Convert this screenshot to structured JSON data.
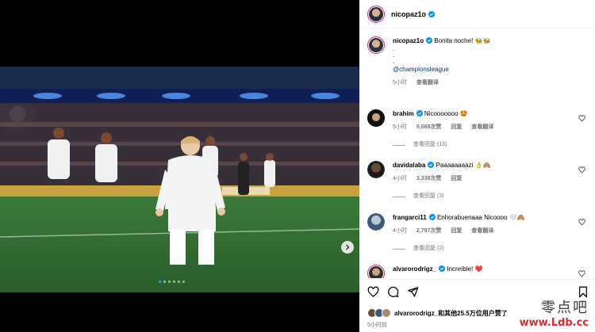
{
  "post": {
    "username": "nicopaz1o",
    "caption_lines": [
      "Bonita noche! 🐝🐝",
      ".",
      ".",
      "."
    ],
    "caption_mention": "@championsleague",
    "caption_time": "5小时",
    "caption_translate": "查看翻译",
    "carousel": {
      "total": 6,
      "active_index": 0
    }
  },
  "comments": [
    {
      "username": "brahim",
      "text": "Nicooooooo 🤩",
      "time": "5小时",
      "likes": "5,668次赞",
      "reply": "回复",
      "translate": "查看翻译",
      "view_replies": "查看回复 (13)"
    },
    {
      "username": "davidalaba",
      "text": "Paaaaaaaazi 👌🙈",
      "time": "4小时",
      "likes": "3,338次赞",
      "reply": "回复",
      "translate": "",
      "view_replies": "查看回复 (3)"
    },
    {
      "username": "frangarci11",
      "text": "Enhorabuenaaa Nicoooo 🤍🙈",
      "time": "4小时",
      "likes": "2,797次赞",
      "reply": "回复",
      "translate": "查看翻译",
      "view_replies": "查看回复 (2)"
    },
    {
      "username": "alvarorodrigz_",
      "text": "Increíble! ❤️",
      "time": "",
      "likes": "",
      "reply": "",
      "translate": "",
      "view_replies": ""
    }
  ],
  "footer": {
    "liked_by_user": "alvarorodrigz_",
    "liked_by_rest": "和其他25.5万位用户赞了",
    "time_ago": "5小时前"
  },
  "watermark": {
    "cn": "零点吧",
    "url": "www.Ldb.cc"
  },
  "colors": {
    "verified": "#0095f6",
    "link": "#00376b",
    "muted": "#737373",
    "carousel_active": "#3897f0"
  }
}
